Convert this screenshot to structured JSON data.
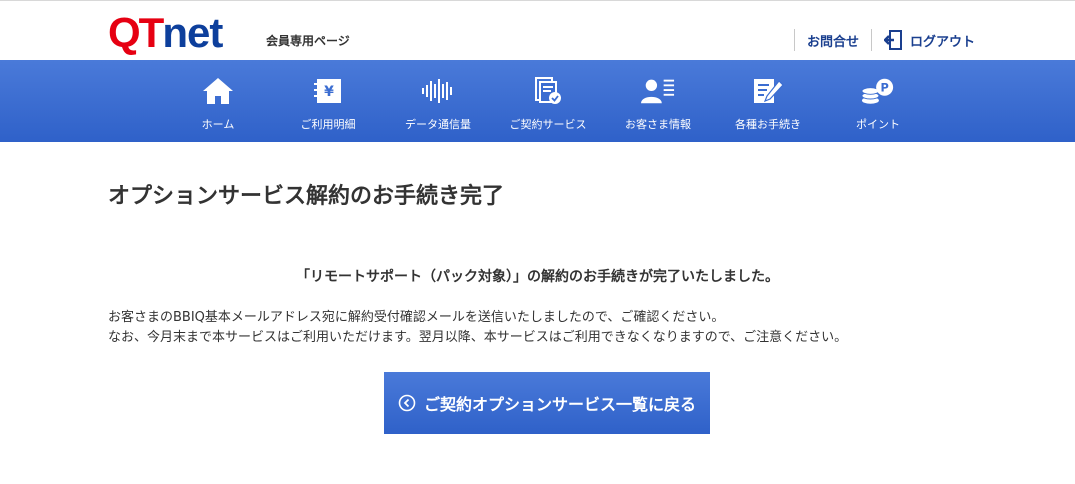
{
  "header": {
    "logo_q": "Q",
    "logo_t": "T",
    "logo_rest": "net",
    "member_label": "会員専用ページ",
    "inquiry_label": "お問合せ",
    "logout_label": "ログアウト"
  },
  "nav": {
    "items": [
      {
        "label": "ホーム",
        "icon": "home-icon"
      },
      {
        "label": "ご利用明細",
        "icon": "billing-statement-icon"
      },
      {
        "label": "データ通信量",
        "icon": "data-usage-icon"
      },
      {
        "label": "ご契約サービス",
        "icon": "contract-service-icon"
      },
      {
        "label": "お客さま情報",
        "icon": "customer-info-icon"
      },
      {
        "label": "各種お手続き",
        "icon": "procedures-icon"
      },
      {
        "label": "ポイント",
        "icon": "points-icon"
      }
    ]
  },
  "main": {
    "title": "オプションサービス解約のお手続き完了",
    "completion_message": "「リモートサポート（パック対象）」の解約のお手続きが完了いたしました。",
    "info_line1": "お客さまのBBIQ基本メールアドレス宛に解約受付確認メールを送信いたしましたので、ご確認ください。",
    "info_line2": "なお、今月末まで本サービスはご利用いただけます。翌月以降、本サービスはご利用できなくなりますので、ご注意ください。",
    "back_button_label": "ご契約オプションサービス一覧に戻る"
  },
  "colors": {
    "logo_red": "#e60012",
    "logo_blue": "#0d3f9c",
    "nav_blue": "#3b6dd1",
    "link_blue": "#1a3f8f"
  }
}
